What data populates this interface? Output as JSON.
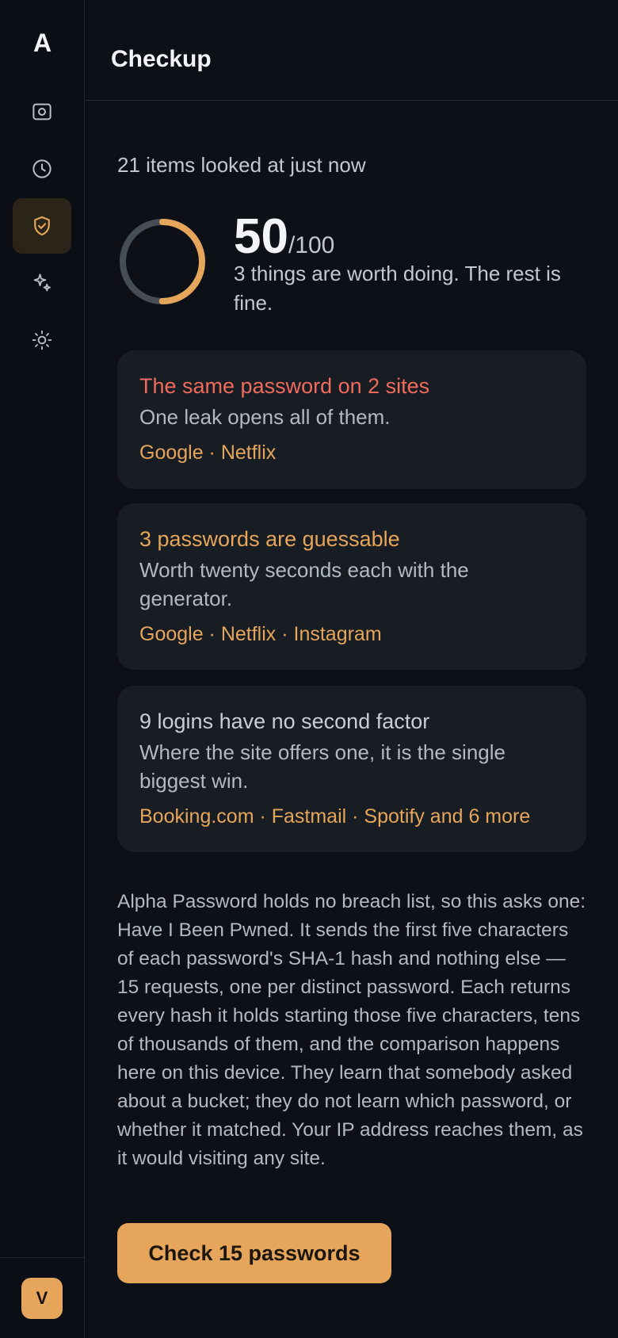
{
  "sidebar": {
    "logo": "A",
    "items": [
      {
        "name": "vault",
        "icon": "vault-icon"
      },
      {
        "name": "history",
        "icon": "clock-icon"
      },
      {
        "name": "checkup",
        "icon": "shield-check-icon",
        "active": true
      },
      {
        "name": "generator",
        "icon": "sparkles-icon"
      },
      {
        "name": "settings",
        "icon": "sun-icon"
      }
    ],
    "avatar": "V"
  },
  "header": {
    "title": "Checkup"
  },
  "checkup": {
    "scan_status": "21 items looked at just now",
    "score": "50",
    "score_max": "/100",
    "score_fraction": 0.5,
    "summary": "3 things are worth doing. The rest is fine.",
    "issues": [
      {
        "title": "The same password on 2 sites",
        "description": "One leak opens all of them.",
        "sites": "Google · Netflix",
        "severity": "high"
      },
      {
        "title": "3 passwords are guessable",
        "description": "Worth twenty seconds each with the generator.",
        "sites": "Google · Netflix · Instagram",
        "severity": "medium"
      },
      {
        "title": "9 logins have no second factor",
        "description": "Where the site offers one, it is the single biggest win.",
        "sites": "Booking.com · Fastmail · Spotify and 6 more",
        "severity": "low"
      }
    ],
    "explanation": "Alpha Password holds no breach list, so this asks one: Have I Been Pwned. It sends the first five characters of each password's SHA-1 hash and nothing else — 15 requests, one per distinct password. Each returns every hash it holds starting those five characters, tens of thousands of them, and the comparison happens here on this device. They learn that somebody asked about a bucket; they do not learn which password, or whether it matched. Your IP address reaches them, as it would visiting any site.",
    "check_button": "Check 15 passwords"
  },
  "colors": {
    "accent": "#e5a55a",
    "danger": "#ef6b5e",
    "background": "#0d1117",
    "card": "#181c23"
  }
}
